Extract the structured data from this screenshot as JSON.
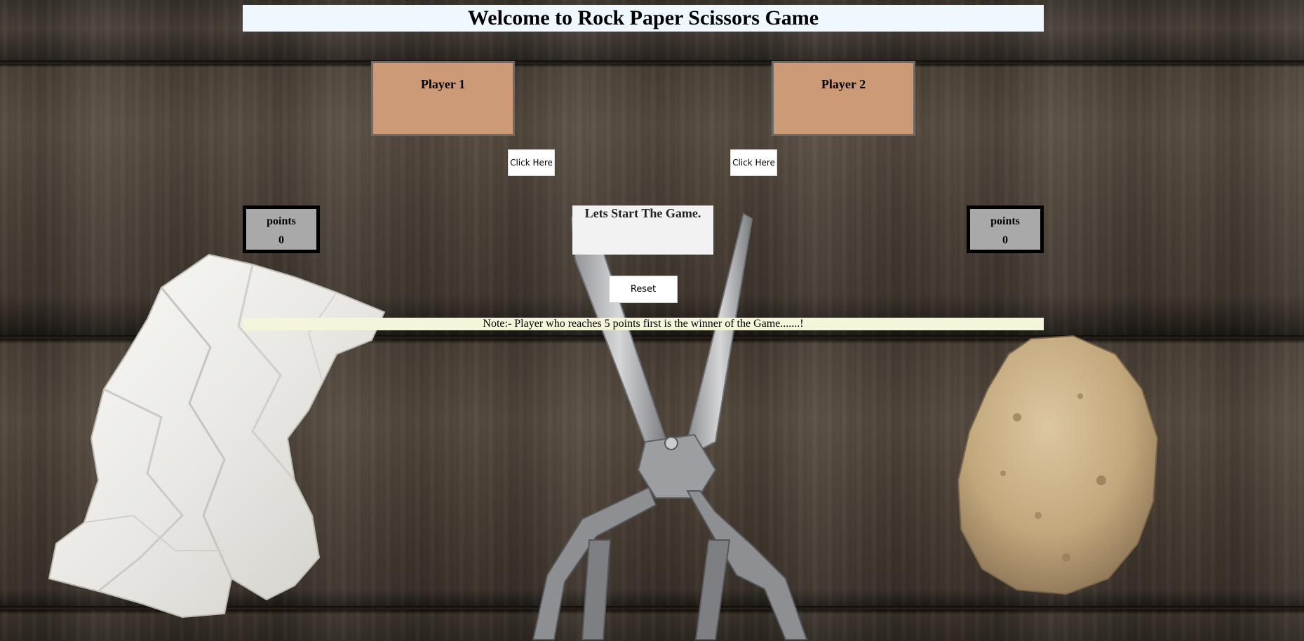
{
  "header": {
    "title": "Welcome to Rock Paper Scissors Game"
  },
  "players": [
    {
      "label": "Player 1",
      "button_label": "Click Here",
      "points_label": "points",
      "points": "0"
    },
    {
      "label": "Player 2",
      "button_label": "Click Here",
      "points_label": "points",
      "points": "0"
    }
  ],
  "status": {
    "message": "Lets Start The Game."
  },
  "controls": {
    "reset_label": "Reset"
  },
  "note": {
    "text": "Note:- Player who reaches 5 points first is the winner of the Game.......!"
  },
  "decorations": {
    "left_image": "crumpled-paper-icon",
    "center_image": "scissors-icon",
    "right_image": "rock-icon"
  },
  "colors": {
    "title_background": "#f0f8ff",
    "player_box": "#cd9a78",
    "points_box": "#a9a9a9",
    "note_background": "#f5f5dc",
    "status_background": "#f2f2f2"
  }
}
